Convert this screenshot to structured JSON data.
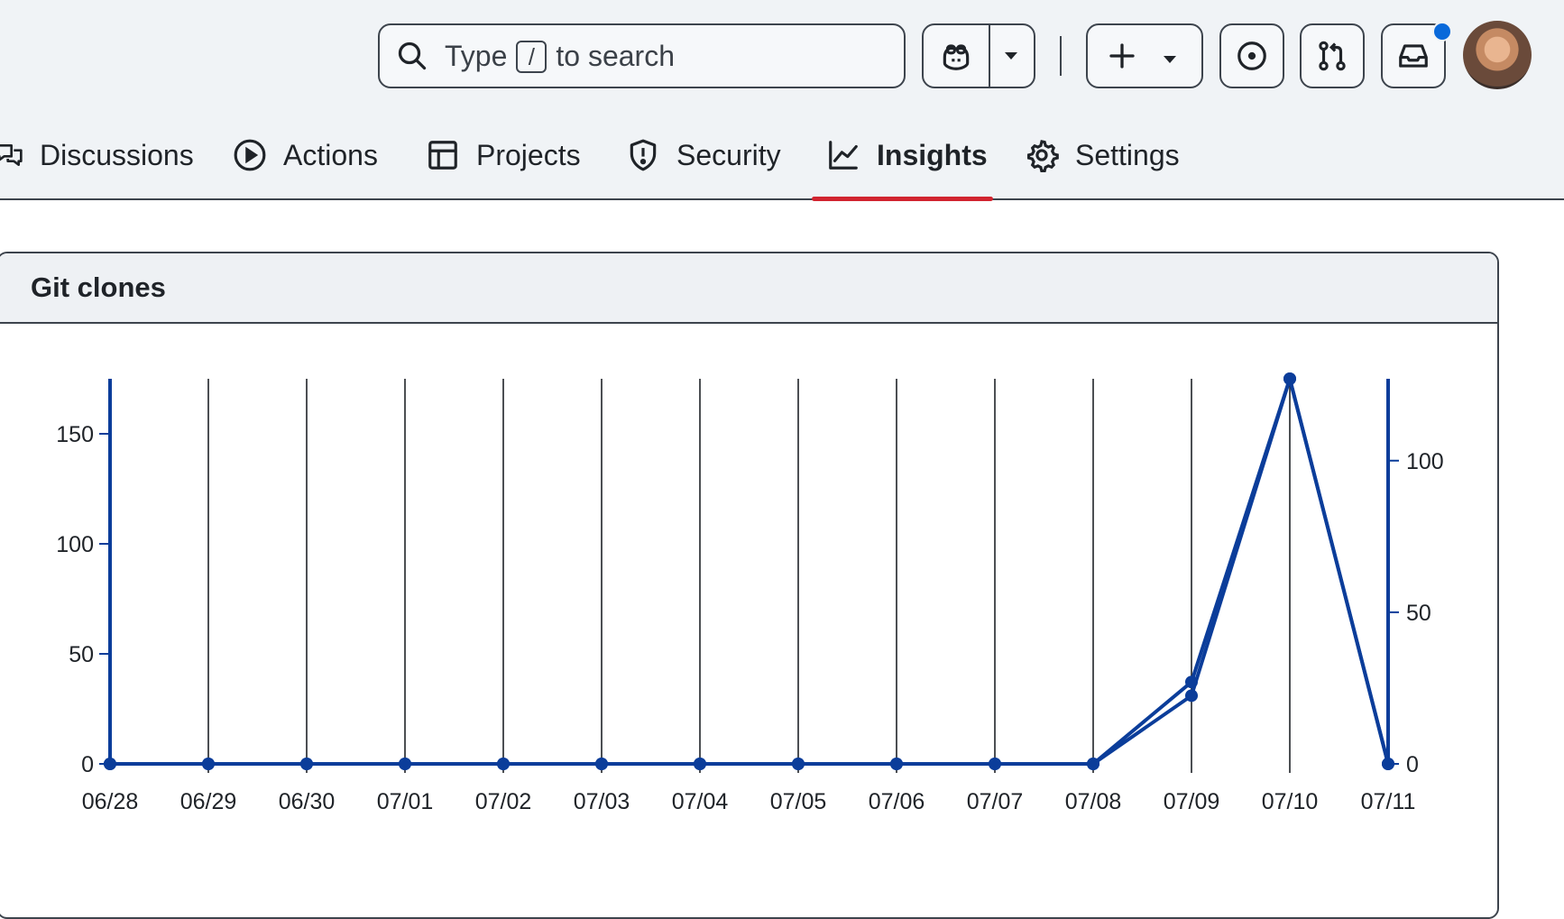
{
  "header": {
    "search": {
      "prefix": "Type",
      "key": "/",
      "suffix": "to search"
    },
    "icons": [
      "search-icon",
      "copilot-icon",
      "chevron-down-icon",
      "plus-icon",
      "issues-icon",
      "pull-request-icon",
      "inbox-icon",
      "avatar"
    ]
  },
  "tabs": [
    {
      "label": "Discussions",
      "icon": "discussions-icon",
      "active": false
    },
    {
      "label": "Actions",
      "icon": "play-icon",
      "active": false
    },
    {
      "label": "Projects",
      "icon": "table-icon",
      "active": false
    },
    {
      "label": "Security",
      "icon": "shield-icon",
      "active": false
    },
    {
      "label": "Insights",
      "icon": "graph-icon",
      "active": true
    },
    {
      "label": "Settings",
      "icon": "gear-icon",
      "active": false
    }
  ],
  "panel": {
    "title": "Git clones"
  },
  "colors": {
    "accent": "#0b3d9a",
    "active_tab": "#d1242f",
    "notification": "#0969da"
  },
  "chart_data": {
    "type": "line",
    "categories": [
      "06/28",
      "06/29",
      "06/30",
      "07/01",
      "07/02",
      "07/03",
      "07/04",
      "07/05",
      "07/06",
      "07/07",
      "07/08",
      "07/09",
      "07/10",
      "07/11"
    ],
    "series": [
      {
        "axis": "left",
        "values": [
          0,
          0,
          0,
          0,
          0,
          0,
          0,
          0,
          0,
          0,
          0,
          31,
          175,
          0
        ]
      },
      {
        "axis": "right",
        "values": [
          0,
          0,
          0,
          0,
          0,
          0,
          0,
          0,
          0,
          0,
          0,
          27,
          127,
          0
        ]
      }
    ],
    "left_axis": {
      "ticks": [
        0,
        50,
        100,
        150
      ],
      "ylim": [
        0,
        175
      ]
    },
    "right_axis": {
      "ticks": [
        0,
        50,
        100
      ],
      "ylim": [
        0,
        127
      ]
    },
    "grid": "vertical"
  }
}
